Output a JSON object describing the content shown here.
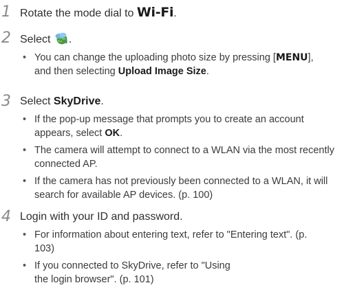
{
  "steps": [
    {
      "number": "1",
      "text": "Rotate the mode dial to ",
      "mode": "Wi-Fi",
      "end": "."
    },
    {
      "number": "2",
      "text": "Select ",
      "icon": "cloud-globe-icon",
      "end": ".",
      "bullets": [
        {
          "a": "You can change the uploading photo size by pressing [",
          "key": "MENU",
          "b": "], and then selecting ",
          "bold": "Upload Image Size",
          "c": "."
        }
      ]
    },
    {
      "number": "3",
      "text": "Select ",
      "bold": "SkyDrive",
      "end": ".",
      "bullets": [
        {
          "a": "If the pop-up message that prompts you to create an account appears, select ",
          "bold": "OK",
          "c": "."
        },
        {
          "a": "The camera will attempt to connect to a WLAN via the most recently connected AP."
        },
        {
          "a": "If the camera has not previously been connected to a WLAN, it will search for available AP devices. (p. 100)"
        }
      ]
    },
    {
      "number": "4",
      "text": "Login with your ID and password.",
      "bullets": [
        {
          "a": "For information about entering text, refer to \"Entering text\". (p. 103)"
        },
        {
          "a": "If you connected to SkyDrive, refer to \"Using the login browser\". (p. 101)"
        }
      ]
    }
  ],
  "colors": {
    "text": "#3a3a3a",
    "step_number": "#8a8a8a",
    "icon_cloud": "#5aa9d6",
    "icon_globe": "#4f9a3c"
  }
}
